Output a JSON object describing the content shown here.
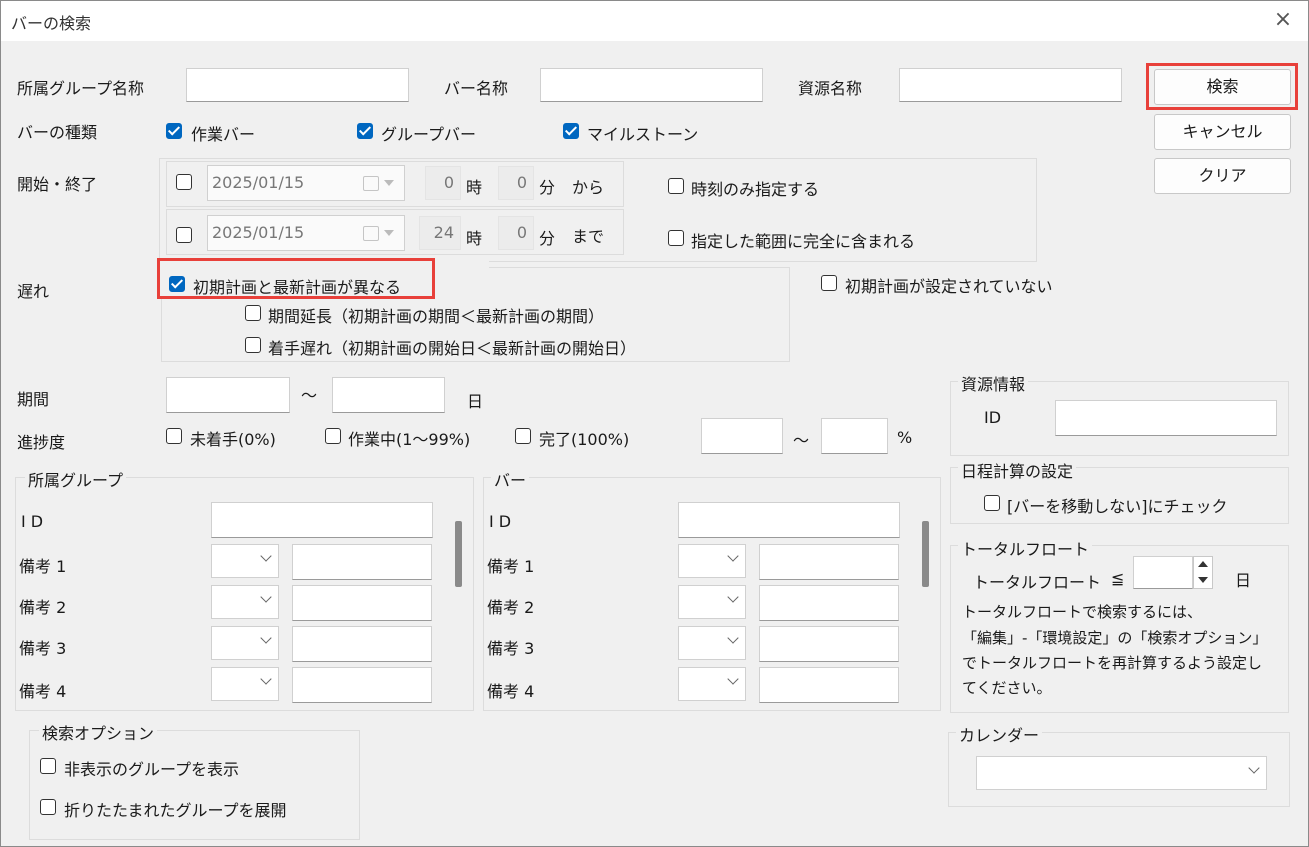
{
  "window": {
    "title": "バーの検索",
    "close": "×"
  },
  "row1": {
    "group_name_label": "所属グループ名称",
    "bar_name_label": "バー名称",
    "resource_name_label": "資源名称"
  },
  "buttons": {
    "search": "検索",
    "cancel": "キャンセル",
    "clear": "クリア"
  },
  "bar_type": {
    "label": "バーの種類",
    "work": "作業バー",
    "group": "グループバー",
    "milestone": "マイルストーン"
  },
  "start_end": {
    "label": "開始・終了",
    "start": {
      "date": "2025/01/15",
      "hour": "0",
      "hour_unit": "時",
      "minute": "0",
      "minute_unit": "分",
      "suffix": "から"
    },
    "end": {
      "date": "2025/01/15",
      "hour": "24",
      "hour_unit": "時",
      "minute": "0",
      "minute_unit": "分",
      "suffix": "まで"
    },
    "time_only": "時刻のみ指定する",
    "fully_contained": "指定した範囲に完全に含まれる"
  },
  "delay": {
    "label": "遅れ",
    "differs": "初期計画と最新計画が異なる",
    "period_extension": "期間延長（初期計画の期間＜最新計画の期間）",
    "late_start": "着手遅れ（初期計画の開始日＜最新計画の開始日）",
    "no_initial_plan": "初期計画が設定されていない"
  },
  "period": {
    "label": "期間",
    "tilde": "～",
    "unit": "日"
  },
  "progress": {
    "label": "進捗度",
    "not_started": "未着手(0%)",
    "in_progress": "作業中(1～99%)",
    "done": "完了(100%)",
    "tilde": "～",
    "unit": "%"
  },
  "group_panel": {
    "title": "所属グループ",
    "id": "I D",
    "remarks": [
      "備考 1",
      "備考 2",
      "備考 3",
      "備考 4"
    ]
  },
  "bar_panel": {
    "title": "バー",
    "id": "I D",
    "remarks": [
      "備考 1",
      "備考 2",
      "備考 3",
      "備考 4"
    ]
  },
  "resource_info": {
    "title": "資源情報",
    "id": "ID"
  },
  "schedule_calc": {
    "title": "日程計算の設定",
    "option": "[バーを移動しない]にチェック"
  },
  "total_float": {
    "title": "トータルフロート",
    "label": "トータルフロート",
    "op": "≦",
    "unit": "日",
    "note_lines": [
      "トータルフロートで検索するには、",
      "「編集」-「環境設定」の「検索オプション」",
      "でトータルフロートを再計算するよう設定し",
      "てください。"
    ]
  },
  "search_options": {
    "title": "検索オプション",
    "show_hidden": "非表示のグループを表示",
    "expand_collapsed": "折りたたまれたグループを展開"
  },
  "calendar": {
    "title": "カレンダー"
  },
  "colors": {
    "accent": "#0067c0",
    "highlight": "#e8403a"
  }
}
